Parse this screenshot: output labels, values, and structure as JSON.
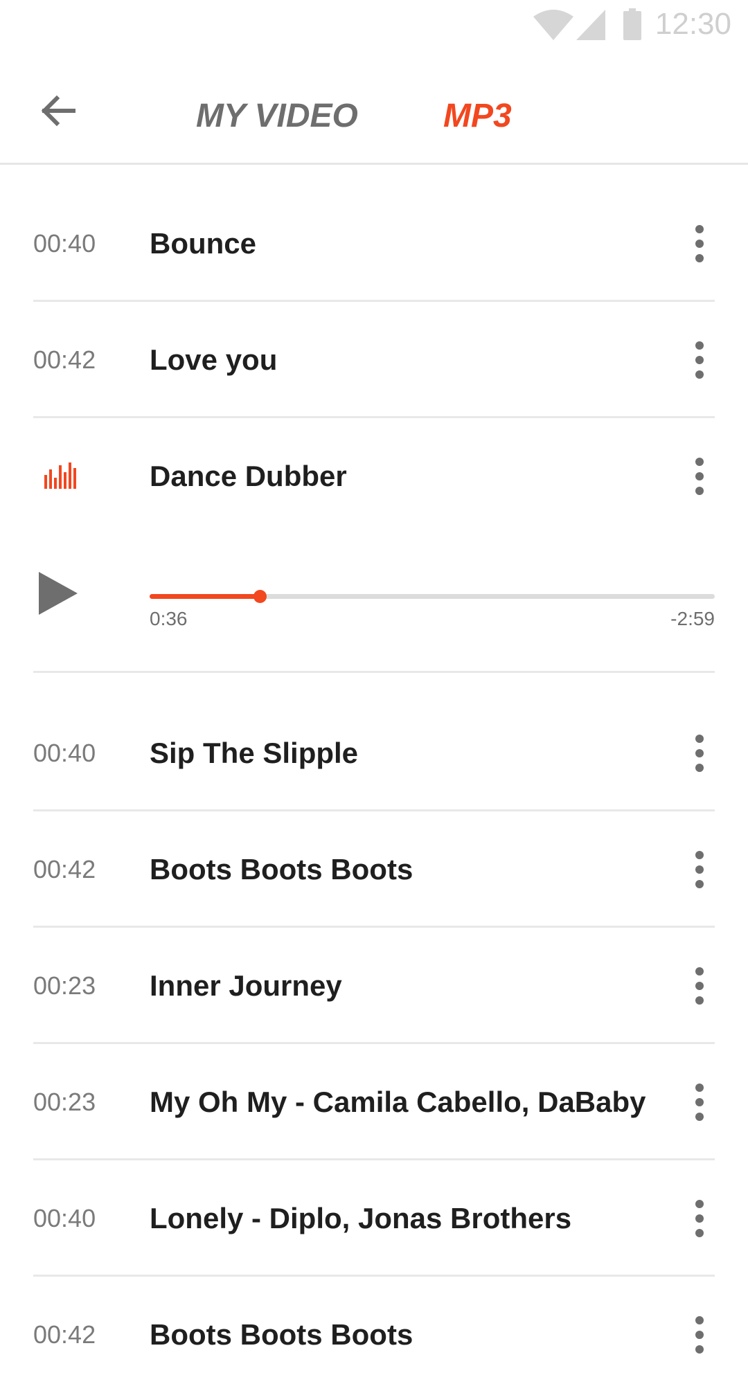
{
  "status_bar": {
    "time": "12:30",
    "icons": [
      "wifi-icon",
      "signal-icon",
      "battery-icon"
    ]
  },
  "header": {
    "back_icon": "arrow-left-icon",
    "tabs": [
      {
        "label": "MY VIDEO",
        "active": false
      },
      {
        "label": "MP3",
        "active": true
      }
    ]
  },
  "colors": {
    "accent": "#f2471f",
    "text": "#1f1f1f",
    "muted": "#7a7a7a",
    "divider": "#e8e8e8"
  },
  "tracks_top": [
    {
      "duration": "00:40",
      "title": "Bounce"
    },
    {
      "duration": "00:42",
      "title": "Love you"
    }
  ],
  "now_playing": {
    "title": "Dance Dubber",
    "indicator_icon": "equalizer-icon",
    "elapsed": "0:36",
    "remaining": "-2:59",
    "progress": 0.195
  },
  "tracks_bottom": [
    {
      "duration": "00:40",
      "title": "Sip The Slipple"
    },
    {
      "duration": "00:42",
      "title": "Boots Boots Boots"
    },
    {
      "duration": "00:23",
      "title": "Inner Journey"
    },
    {
      "duration": "00:23",
      "title": "My Oh My - Camila Cabello, DaBaby"
    },
    {
      "duration": "00:40",
      "title": "Lonely - Diplo, Jonas Brothers"
    },
    {
      "duration": "00:42",
      "title": "Boots Boots Boots"
    }
  ]
}
